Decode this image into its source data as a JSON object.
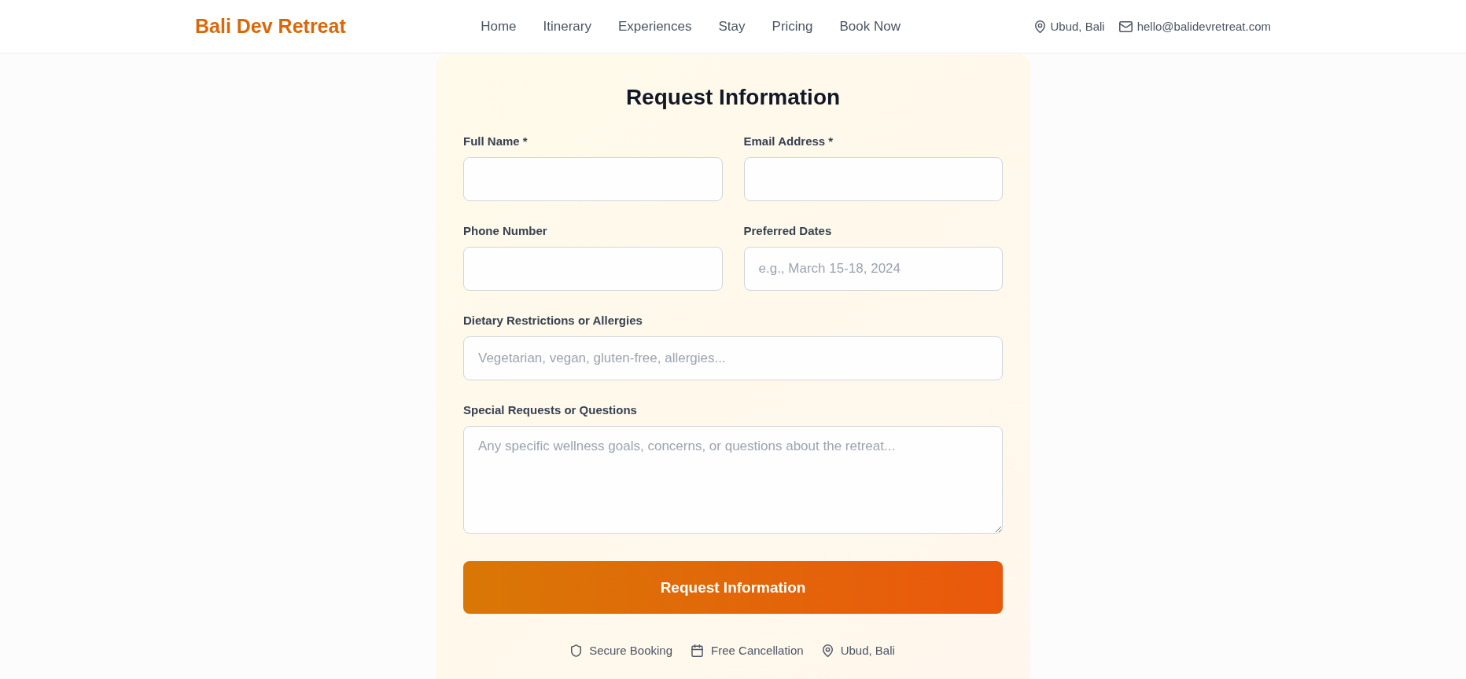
{
  "header": {
    "logo": "Bali Dev Retreat",
    "nav": [
      "Home",
      "Itinerary",
      "Experiences",
      "Stay",
      "Pricing",
      "Book Now"
    ],
    "contact": [
      {
        "kind": "location",
        "text": "Ubud, Bali"
      },
      {
        "kind": "email",
        "text": "hello@balidevretreat.com"
      }
    ]
  },
  "form": {
    "title": "Request Information",
    "rows": [
      [
        {
          "kind": "input",
          "label": "Full Name *"
        },
        {
          "kind": "input",
          "label": "Email Address *"
        }
      ],
      [
        {
          "kind": "input",
          "label": "Phone Number"
        },
        {
          "kind": "input",
          "label": "Preferred Dates",
          "placeholder": "e.g., March 15-18, 2024"
        }
      ],
      [
        {
          "kind": "input",
          "label": "Dietary Restrictions or Allergies",
          "placeholder": "Vegetarian, vegan, gluten-free, allergies..."
        }
      ],
      [
        {
          "kind": "textarea",
          "label": "Special Requests or Questions",
          "placeholder": "Any specific wellness goals, concerns, or questions about the retreat..."
        }
      ]
    ],
    "submit": "Request Information",
    "badges": [
      {
        "kind": "security",
        "text": "Secure Booking"
      },
      {
        "kind": "cancellation",
        "text": "Free Cancellation"
      },
      {
        "kind": "location",
        "text": "Ubud, Bali"
      }
    ]
  }
}
